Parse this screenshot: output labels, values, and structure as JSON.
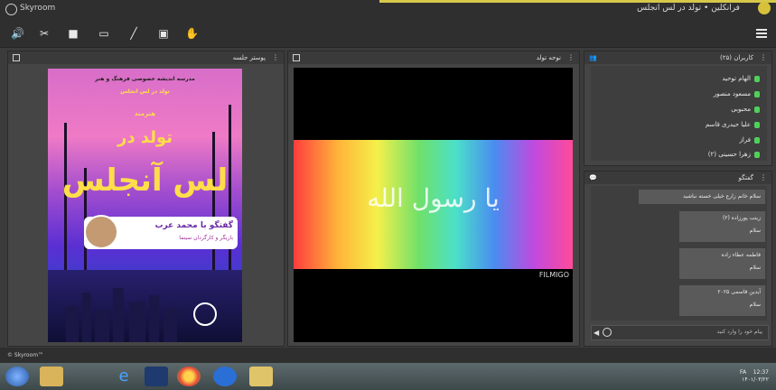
{
  "window": {
    "app_title": "Skyroom",
    "session_title": "فرانکلین • تولد در لس انجلس"
  },
  "toolbar": {
    "tools": [
      "speaker-icon",
      "mic-off-icon",
      "camera-icon",
      "screen-share-icon",
      "pen-icon",
      "whiteboard-icon",
      "raise-hand-icon"
    ],
    "menu": "menu-icon"
  },
  "panels": {
    "document": {
      "title": "پوستر جلسه"
    },
    "video": {
      "title": "نوحه تولد",
      "watermark": "FILMIGO",
      "calligraphy": "یا رسول الله"
    },
    "users": {
      "title": "کاربران (۲۵)",
      "items": [
        {
          "name": "الهام توحید"
        },
        {
          "name": "مسعود منصور"
        },
        {
          "name": "محبوبی"
        },
        {
          "name": "علیا حیدری قاسم"
        },
        {
          "name": "فراز"
        },
        {
          "name": "زهرا حسینی (۲)"
        }
      ]
    },
    "chat": {
      "title": "گفتگو",
      "messages": [
        {
          "text": "سلام خانم زارع خیلی خسته نباشید"
        },
        {
          "title": "زینب پورزاده (۲)",
          "body": "سلام"
        },
        {
          "title": "فاطمه عطاء زاده",
          "body": "سلام"
        },
        {
          "title": "آیدین قاسمی ۲۰۲۵",
          "body": "سلام"
        }
      ],
      "input_placeholder": "پیام خود را وارد کنید"
    }
  },
  "poster": {
    "line1": "مدرسه اندیشه خصوصی فرهنگ و هنر",
    "line2": "تولد در لس انجلس",
    "line3": "هنرمند",
    "line4": "تولد در",
    "line5": "لس آنجلس",
    "guest_name": "گفتگو با محمد عرب",
    "guest_role": "بازیگر و کارگردان سینما"
  },
  "footer": {
    "brand": "© Skyroom™"
  },
  "taskbar": {
    "apps": [
      "start-icon",
      "file-explorer-icon",
      "edge-icon",
      "photoshop-icon",
      "chrome-icon",
      "media-icon",
      "folder-icon"
    ],
    "clock": "12:37",
    "date": "۱۴۰۱/۰۳/۲۲",
    "lang": "FA"
  }
}
